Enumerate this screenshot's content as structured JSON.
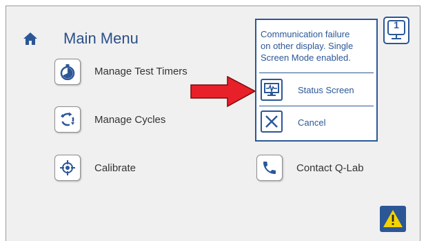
{
  "header": {
    "title": "Main Menu",
    "home_icon": "home-icon"
  },
  "menu": {
    "items": [
      {
        "label": "Manage Test Timers",
        "icon": "stopwatch-icon"
      },
      {
        "label": "Manage Cycles",
        "icon": "cycle-arrows-icon"
      },
      {
        "label": "Calibrate",
        "icon": "crosshair-icon"
      },
      {
        "label": "Contact Q-Lab",
        "icon": "phone-icon"
      }
    ]
  },
  "popup": {
    "message_lines": [
      "Communication failure",
      "on other display.  Single",
      "Screen Mode enabled."
    ],
    "options": [
      {
        "label": "Status Screen",
        "icon": "monitor-pulse-icon"
      },
      {
        "label": "Cancel",
        "icon": "close-icon"
      }
    ]
  },
  "display_indicator": {
    "number": "1"
  },
  "colors": {
    "accent": "#2b5797",
    "arrow": "#e8202a",
    "warning": "#f5d300"
  }
}
